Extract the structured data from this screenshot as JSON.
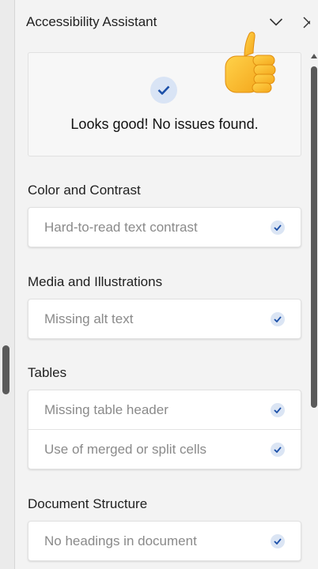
{
  "pane": {
    "title": "Accessibility Assistant",
    "collapse_icon": "chevron-down-icon",
    "close_icon": "close-icon"
  },
  "status": {
    "message": "Looks good! No issues found.",
    "icon": "checkmark-icon",
    "decoration": "thumbs-up-emoji"
  },
  "sections": [
    {
      "title": "Color and Contrast",
      "items": [
        {
          "label": "Hard-to-read text contrast"
        }
      ]
    },
    {
      "title": "Media and Illustrations",
      "items": [
        {
          "label": "Missing alt text"
        }
      ]
    },
    {
      "title": "Tables",
      "items": [
        {
          "label": "Missing table header"
        },
        {
          "label": "Use of merged or split cells"
        }
      ]
    },
    {
      "title": "Document Structure",
      "items": [
        {
          "label": "No headings in document"
        }
      ]
    }
  ],
  "colors": {
    "check_blue": "#1b4fa8",
    "check_bg": "#d9e4f5",
    "muted_text": "#8a8a8a"
  }
}
